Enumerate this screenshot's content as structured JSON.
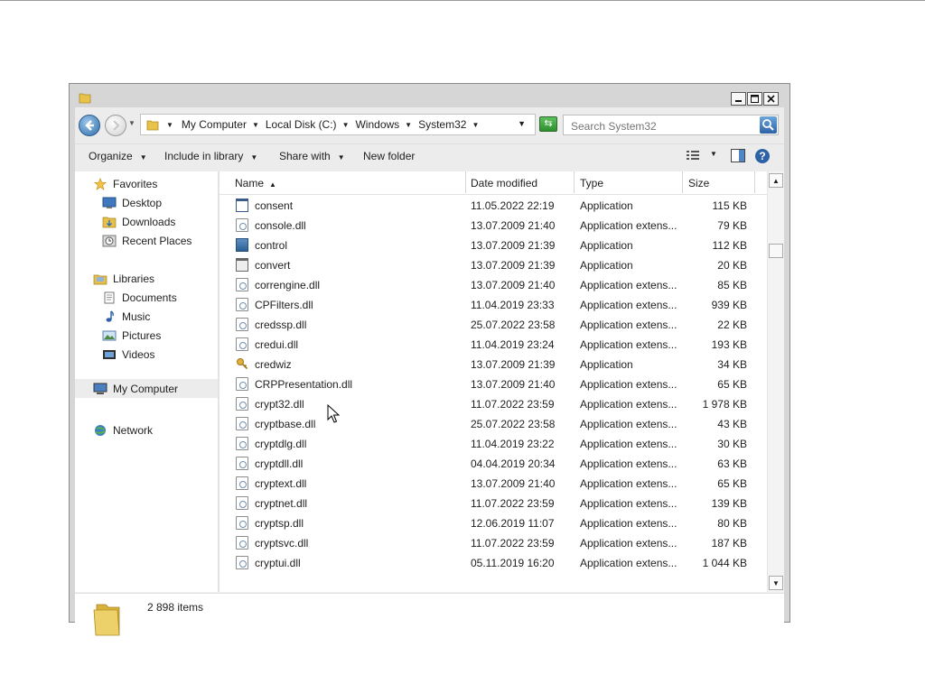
{
  "address": {
    "crumbs": [
      "My Computer",
      "Local Disk (C:)",
      "Windows",
      "System32"
    ]
  },
  "search": {
    "placeholder": "Search System32"
  },
  "toolbar": {
    "organize": "Organize",
    "include": "Include in library",
    "share": "Share with",
    "new_folder": "New folder"
  },
  "nav": {
    "favorites": "Favorites",
    "desktop": "Desktop",
    "downloads": "Downloads",
    "recent": "Recent Places",
    "libraries": "Libraries",
    "documents": "Documents",
    "music": "Music",
    "pictures": "Pictures",
    "videos": "Videos",
    "computer": "My Computer",
    "network": "Network"
  },
  "columns": {
    "name": "Name",
    "date": "Date modified",
    "type": "Type",
    "size": "Size"
  },
  "files": [
    {
      "icon": "app-icon",
      "name": "consent",
      "date": "11.05.2022 22:19",
      "type": "Application",
      "size": "115 KB"
    },
    {
      "icon": "dll-icon",
      "name": "console.dll",
      "date": "13.07.2009 21:40",
      "type": "Application extens...",
      "size": "79 KB"
    },
    {
      "icon": "control-panel-icon",
      "name": "control",
      "date": "13.07.2009 21:39",
      "type": "Application",
      "size": "112 KB"
    },
    {
      "icon": "convert-icon",
      "name": "convert",
      "date": "13.07.2009 21:39",
      "type": "Application",
      "size": "20 KB"
    },
    {
      "icon": "dll-icon",
      "name": "correngine.dll",
      "date": "13.07.2009 21:40",
      "type": "Application extens...",
      "size": "85 KB"
    },
    {
      "icon": "dll-icon",
      "name": "CPFilters.dll",
      "date": "11.04.2019 23:33",
      "type": "Application extens...",
      "size": "939 KB"
    },
    {
      "icon": "dll-icon",
      "name": "credssp.dll",
      "date": "25.07.2022 23:58",
      "type": "Application extens...",
      "size": "22 KB"
    },
    {
      "icon": "dll-icon",
      "name": "credui.dll",
      "date": "11.04.2019 23:24",
      "type": "Application extens...",
      "size": "193 KB"
    },
    {
      "icon": "key-icon",
      "name": "credwiz",
      "date": "13.07.2009 21:39",
      "type": "Application",
      "size": "34 KB"
    },
    {
      "icon": "dll-icon",
      "name": "CRPPresentation.dll",
      "date": "13.07.2009 21:40",
      "type": "Application extens...",
      "size": "65 KB"
    },
    {
      "icon": "dll-icon",
      "name": "crypt32.dll",
      "date": "11.07.2022 23:59",
      "type": "Application extens...",
      "size": "1 978 KB"
    },
    {
      "icon": "dll-icon",
      "name": "cryptbase.dll",
      "date": "25.07.2022 23:58",
      "type": "Application extens...",
      "size": "43 KB"
    },
    {
      "icon": "dll-icon",
      "name": "cryptdlg.dll",
      "date": "11.04.2019 23:22",
      "type": "Application extens...",
      "size": "30 KB"
    },
    {
      "icon": "dll-icon",
      "name": "cryptdll.dll",
      "date": "04.04.2019 20:34",
      "type": "Application extens...",
      "size": "63 KB"
    },
    {
      "icon": "dll-icon",
      "name": "cryptext.dll",
      "date": "13.07.2009 21:40",
      "type": "Application extens...",
      "size": "65 KB"
    },
    {
      "icon": "dll-icon",
      "name": "cryptnet.dll",
      "date": "11.07.2022 23:59",
      "type": "Application extens...",
      "size": "139 KB"
    },
    {
      "icon": "dll-icon",
      "name": "cryptsp.dll",
      "date": "12.06.2019 11:07",
      "type": "Application extens...",
      "size": "80 KB"
    },
    {
      "icon": "dll-icon",
      "name": "cryptsvc.dll",
      "date": "11.07.2022 23:59",
      "type": "Application extens...",
      "size": "187 KB"
    },
    {
      "icon": "dll-icon",
      "name": "cryptui.dll",
      "date": "05.11.2019 16:20",
      "type": "Application extens...",
      "size": "1 044 KB"
    }
  ],
  "status": {
    "count": "2 898 items"
  },
  "colors": {
    "accent": "#2f6ea8",
    "selection": "#ececec",
    "window": "#d6d6d6"
  }
}
